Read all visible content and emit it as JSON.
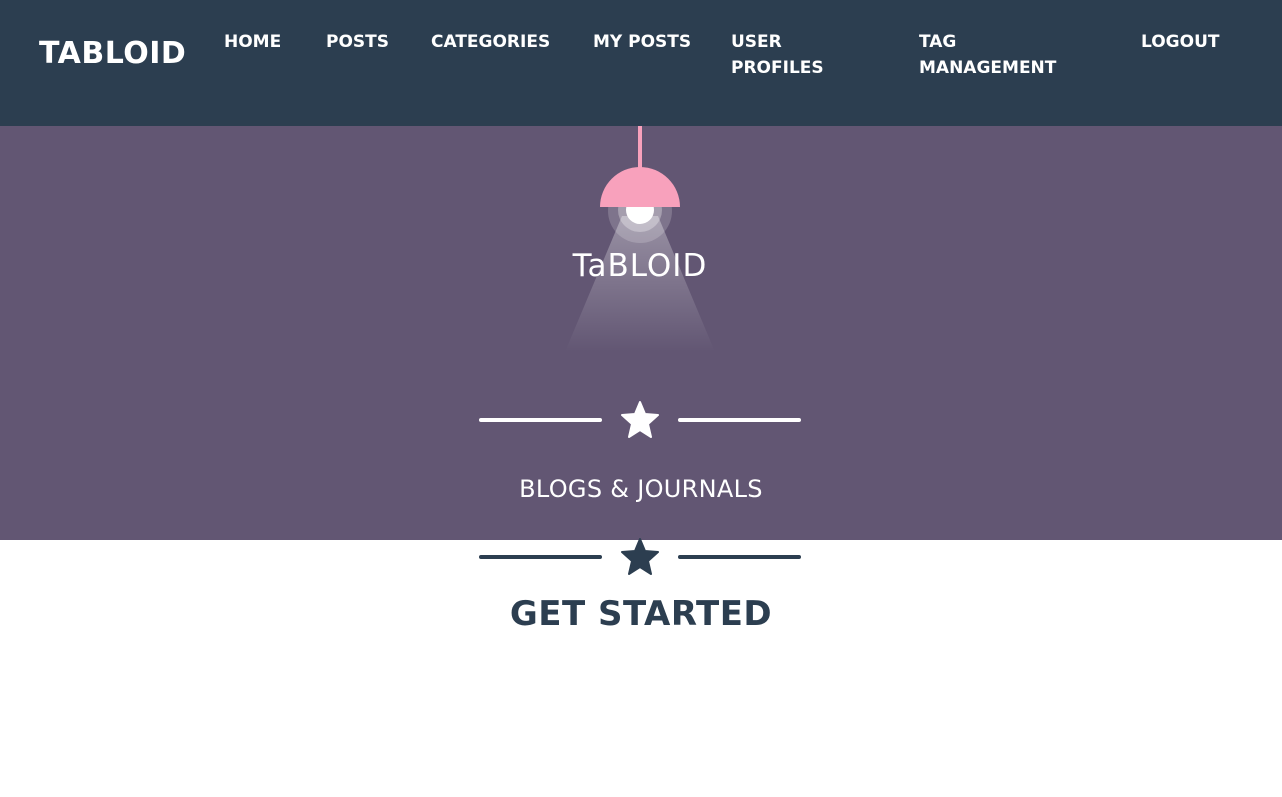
{
  "navbar": {
    "brand": "TABLOID",
    "links": [
      {
        "label": "HOME"
      },
      {
        "label": "POSTS"
      },
      {
        "label": "CATEGORIES"
      },
      {
        "label": "MY POSTS"
      },
      {
        "label": "USER PROFILES"
      },
      {
        "label": "TAG MANAGEMENT"
      },
      {
        "label": "LOGOUT"
      }
    ]
  },
  "hero": {
    "logo_text": "TaBLOID",
    "tagline": "BLOGS & JOURNALS",
    "divider_icon": "star-icon"
  },
  "main": {
    "title": "GET STARTED",
    "divider_icon": "star-icon"
  },
  "colors": {
    "navbar_bg": "#2c3e50",
    "hero_bg": "#625673",
    "lamp_shade": "#f8a1bc",
    "text_light": "#ffffff",
    "text_dark": "#2c3e50"
  }
}
